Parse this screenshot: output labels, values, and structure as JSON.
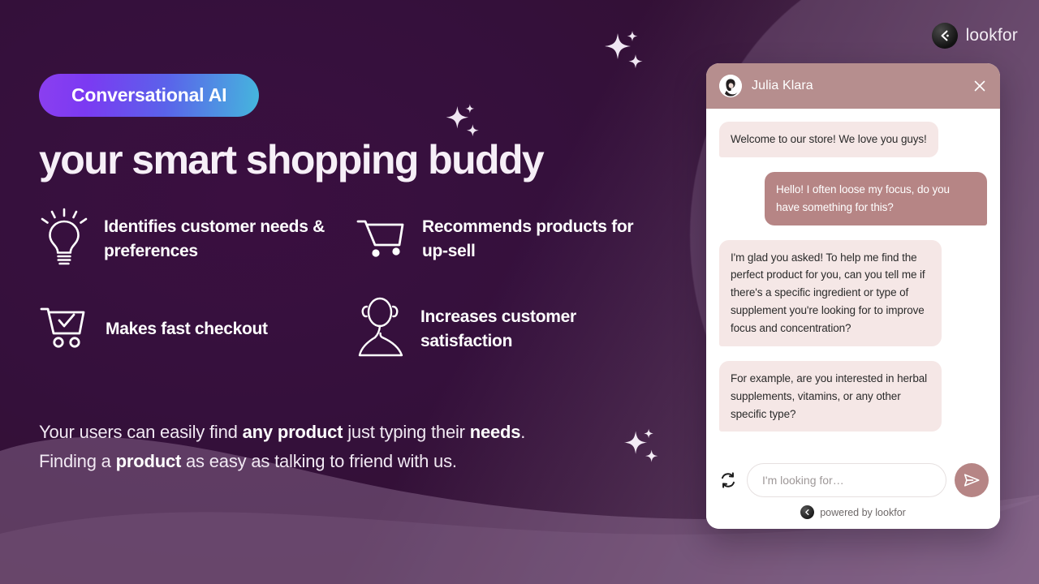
{
  "brand": {
    "logo_text": "lookfor",
    "logo_icon": "lookfor-chevron-icon"
  },
  "hero": {
    "badge_label": "Conversational AI",
    "headline": "your smart shopping buddy",
    "features": [
      {
        "icon": "lightbulb-icon",
        "label": "Identifies customer needs & preferences"
      },
      {
        "icon": "shopping-cart-icon",
        "label": "Recommends products for up-sell"
      },
      {
        "icon": "cart-check-icon",
        "label": "Makes fast checkout"
      },
      {
        "icon": "support-agent-icon",
        "label": "Increases customer satisfaction"
      }
    ],
    "blurb_line1_a": "Your users can easily find ",
    "blurb_line1_b": "any product",
    "blurb_line1_c": " just typing their ",
    "blurb_line1_d": "needs",
    "blurb_line1_e": ".",
    "blurb_line2_a": "Finding a ",
    "blurb_line2_b": "product",
    "blurb_line2_c": " as easy as talking to friend with us."
  },
  "chat": {
    "agent_name": "Julia Klara",
    "avatar_icon": "agent-avatar-icon",
    "close_icon": "close-icon",
    "messages": [
      {
        "sender": "bot",
        "text": "Welcome to our store! We love you guys!"
      },
      {
        "sender": "user",
        "text": "Hello! I often loose my focus, do you have something for this?"
      },
      {
        "sender": "bot",
        "text": "I'm glad you asked! To help me find the perfect product for you, can you tell me if there's a specific ingredient or type of supplement you're looking for to improve focus and concentration?"
      },
      {
        "sender": "bot",
        "text": "For example, are you interested in herbal supplements, vitamins, or any other specific type?"
      }
    ],
    "refresh_icon": "refresh-icon",
    "input_value": "",
    "input_placeholder": "I'm looking for…",
    "send_icon": "send-icon",
    "powered_by": "powered by lookfor",
    "powered_icon": "lookfor-chevron-icon"
  },
  "colors": {
    "badge_gradient_start": "#8b3ff0",
    "badge_gradient_end": "#45b6dd",
    "chat_accent": "#b68585",
    "chat_header": "#b68e8e",
    "bot_bubble": "#f5e7e6",
    "background_dark": "#2b0a2e",
    "background_light": "#86668c"
  }
}
